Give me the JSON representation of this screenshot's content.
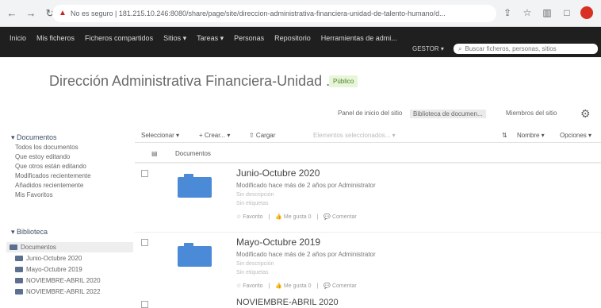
{
  "browser": {
    "back_icon": "←",
    "forward_icon": "→",
    "reload_icon": "↻",
    "warning_icon": "▲",
    "url": "No es seguro | 181.215.10.246:8080/share/page/site/direccion-administrativa-financiera-unidad-de-talento-humano/d...",
    "share_icon": "⇪",
    "star_icon": "☆",
    "profile_color": "#d93025"
  },
  "suite_bar": {
    "nav": [
      "Inicio",
      "Mis ficheros",
      "Ficheros compartidos",
      "Sitios ▾",
      "Tareas ▾",
      "Personas",
      "Repositorio",
      "Herramientas de admi..."
    ],
    "user": "GESTOR ▾",
    "search_placeholder": "Buscar ficheros, personas, sitios"
  },
  "site": {
    "title": "Dirección Administrativa Financiera-Unidad ...",
    "badge": "Público",
    "nav": {
      "dashboard": "Panel de inicio del sitio",
      "library": "Biblioteca de documen...",
      "members": "Miembros del sitio"
    }
  },
  "sidebar": {
    "documents_header": "▾ Documentos",
    "document_links": [
      "Todos los documentos",
      "Que estoy editando",
      "Que otros están editando",
      "Modificados recientemente",
      "Añadidos recientemente",
      "Mis Favoritos"
    ],
    "library_header": "▾ Biblioteca",
    "library_root": "Documentos",
    "folders": [
      "Junio-Octubre 2020",
      "Mayo-Octubre 2019",
      "NOVIEMBRE-ABRIL 2020",
      "NOVIEMBRE-ABRIL 2022"
    ]
  },
  "toolbar": {
    "select": "Seleccionar ▾",
    "create": "+ Crear... ▾",
    "upload": "⇧ Cargar",
    "selected": "Elementos seleccionados... ▾",
    "sort_icon": "⇅",
    "sort": "Nombre ▾",
    "options": "Opciones ▾"
  },
  "list": {
    "column_documents": "Documentos",
    "items": [
      {
        "title": "Junio-Octubre 2020",
        "meta": "Modificado hace más de 2 años por Administrator",
        "description": "Sin descripción",
        "tags": "Sin etiquetas",
        "favorite": "☆ Favorito",
        "like": "👍 Me gusta 0",
        "comment": "💬 Comentar"
      },
      {
        "title": "Mayo-Octubre 2019",
        "meta": "Modificado hace más de 2 años por Administrator",
        "description": "Sin descripción",
        "tags": "Sin etiquetas",
        "favorite": "☆ Favorito",
        "like": "👍 Me gusta 0",
        "comment": "💬 Comentar"
      },
      {
        "title": "NOVIEMBRE-ABRIL 2020"
      }
    ]
  }
}
